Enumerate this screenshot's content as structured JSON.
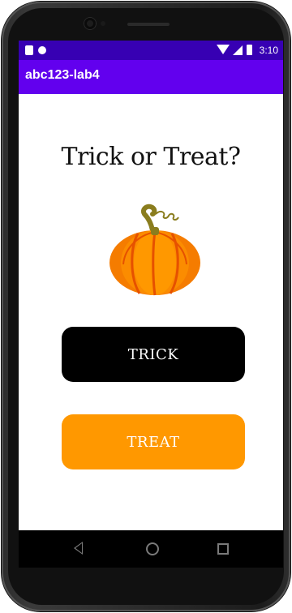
{
  "status_bar": {
    "time": "3:10",
    "icons": [
      "sd-card-icon",
      "notification-dot-icon",
      "wifi-icon",
      "cell-signal-icon",
      "battery-icon"
    ]
  },
  "app_bar": {
    "title": "abc123-lab4"
  },
  "main": {
    "heading": "Trick or Treat?",
    "image": "pumpkin-icon",
    "buttons": {
      "trick_label": "TRICK",
      "treat_label": "TREAT"
    }
  },
  "nav_bar": {
    "icons": [
      "back-icon",
      "home-icon",
      "recents-icon"
    ]
  },
  "colors": {
    "status_bar": "#3700b3",
    "app_bar": "#6200ee",
    "trick_button": "#000000",
    "treat_button": "#ff9800",
    "pumpkin": "#f57c00",
    "stem": "#8a7d1e"
  }
}
